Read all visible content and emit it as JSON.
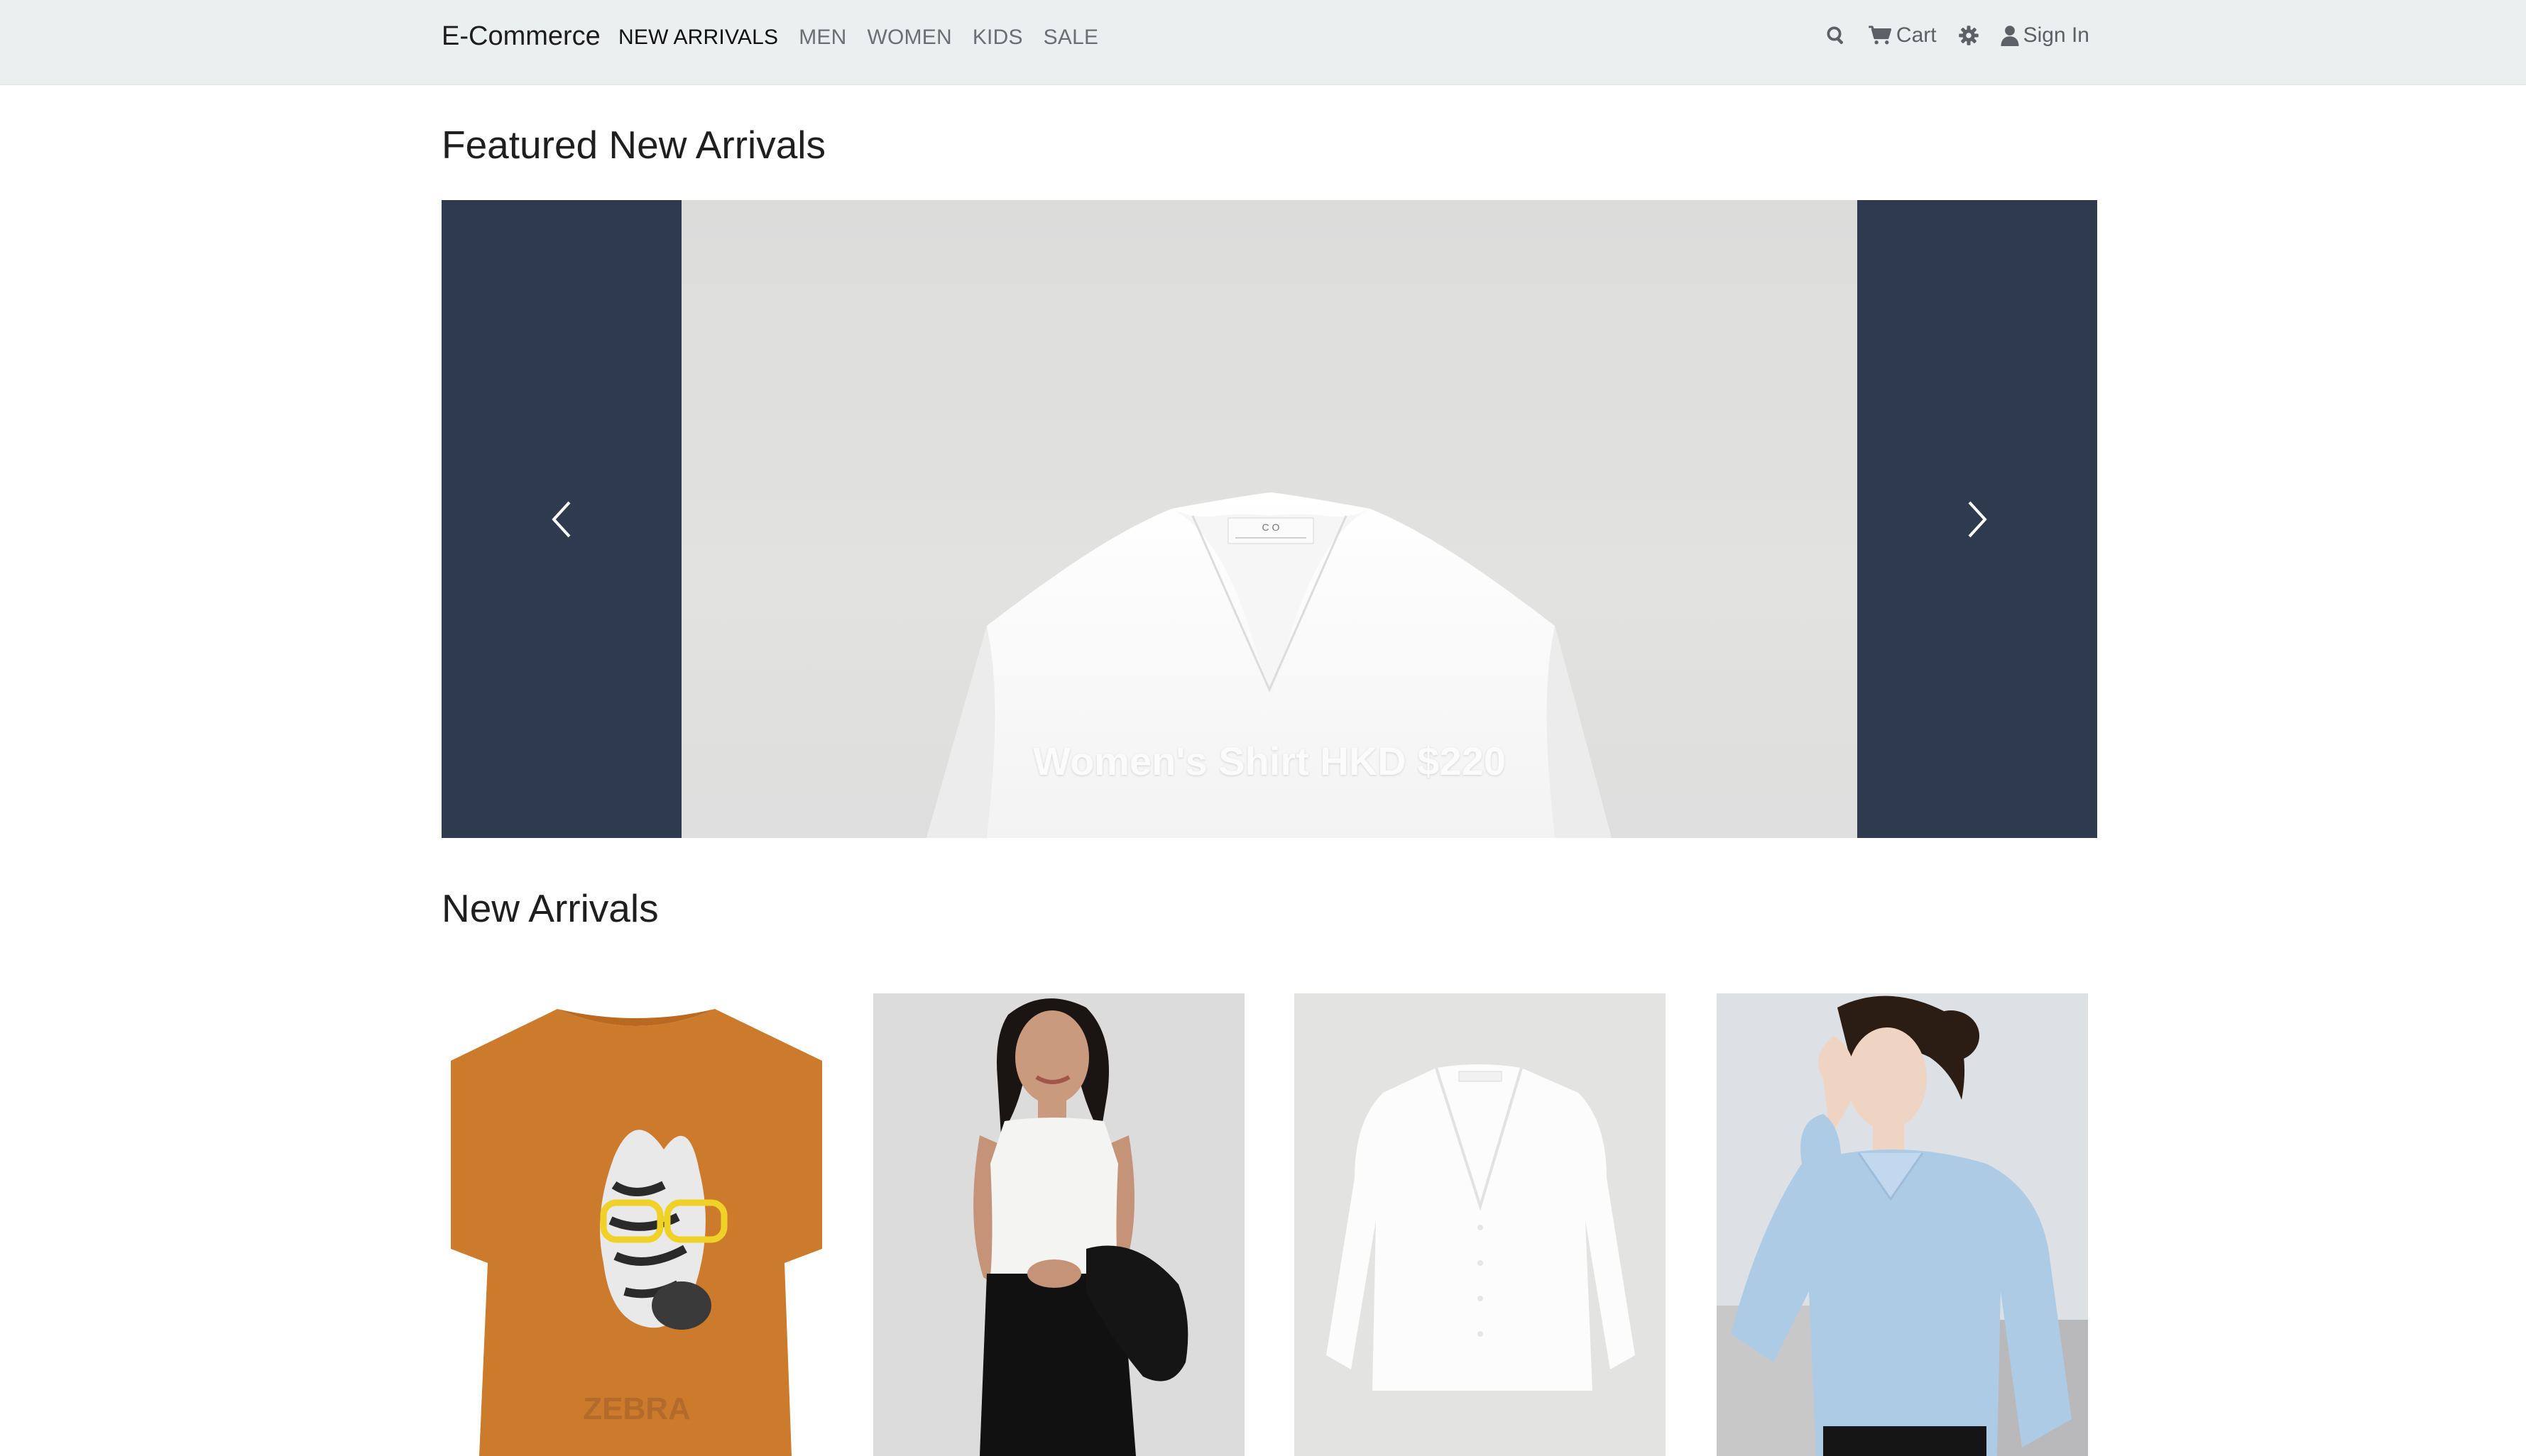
{
  "navbar": {
    "brand": "E-Commerce",
    "links": [
      "NEW ARRIVALS",
      "MEN",
      "WOMEN",
      "KIDS",
      "SALE"
    ],
    "cart_label": "Cart",
    "signin_label": "Sign In"
  },
  "featured": {
    "title": "Featured New Arrivals",
    "slide_caption": "Women's Shirt HKD $220"
  },
  "new_arrivals": {
    "title": "New Arrivals"
  },
  "colors": {
    "navbar_bg": "#eceff0",
    "carousel_bg": "#2e3b4e"
  }
}
